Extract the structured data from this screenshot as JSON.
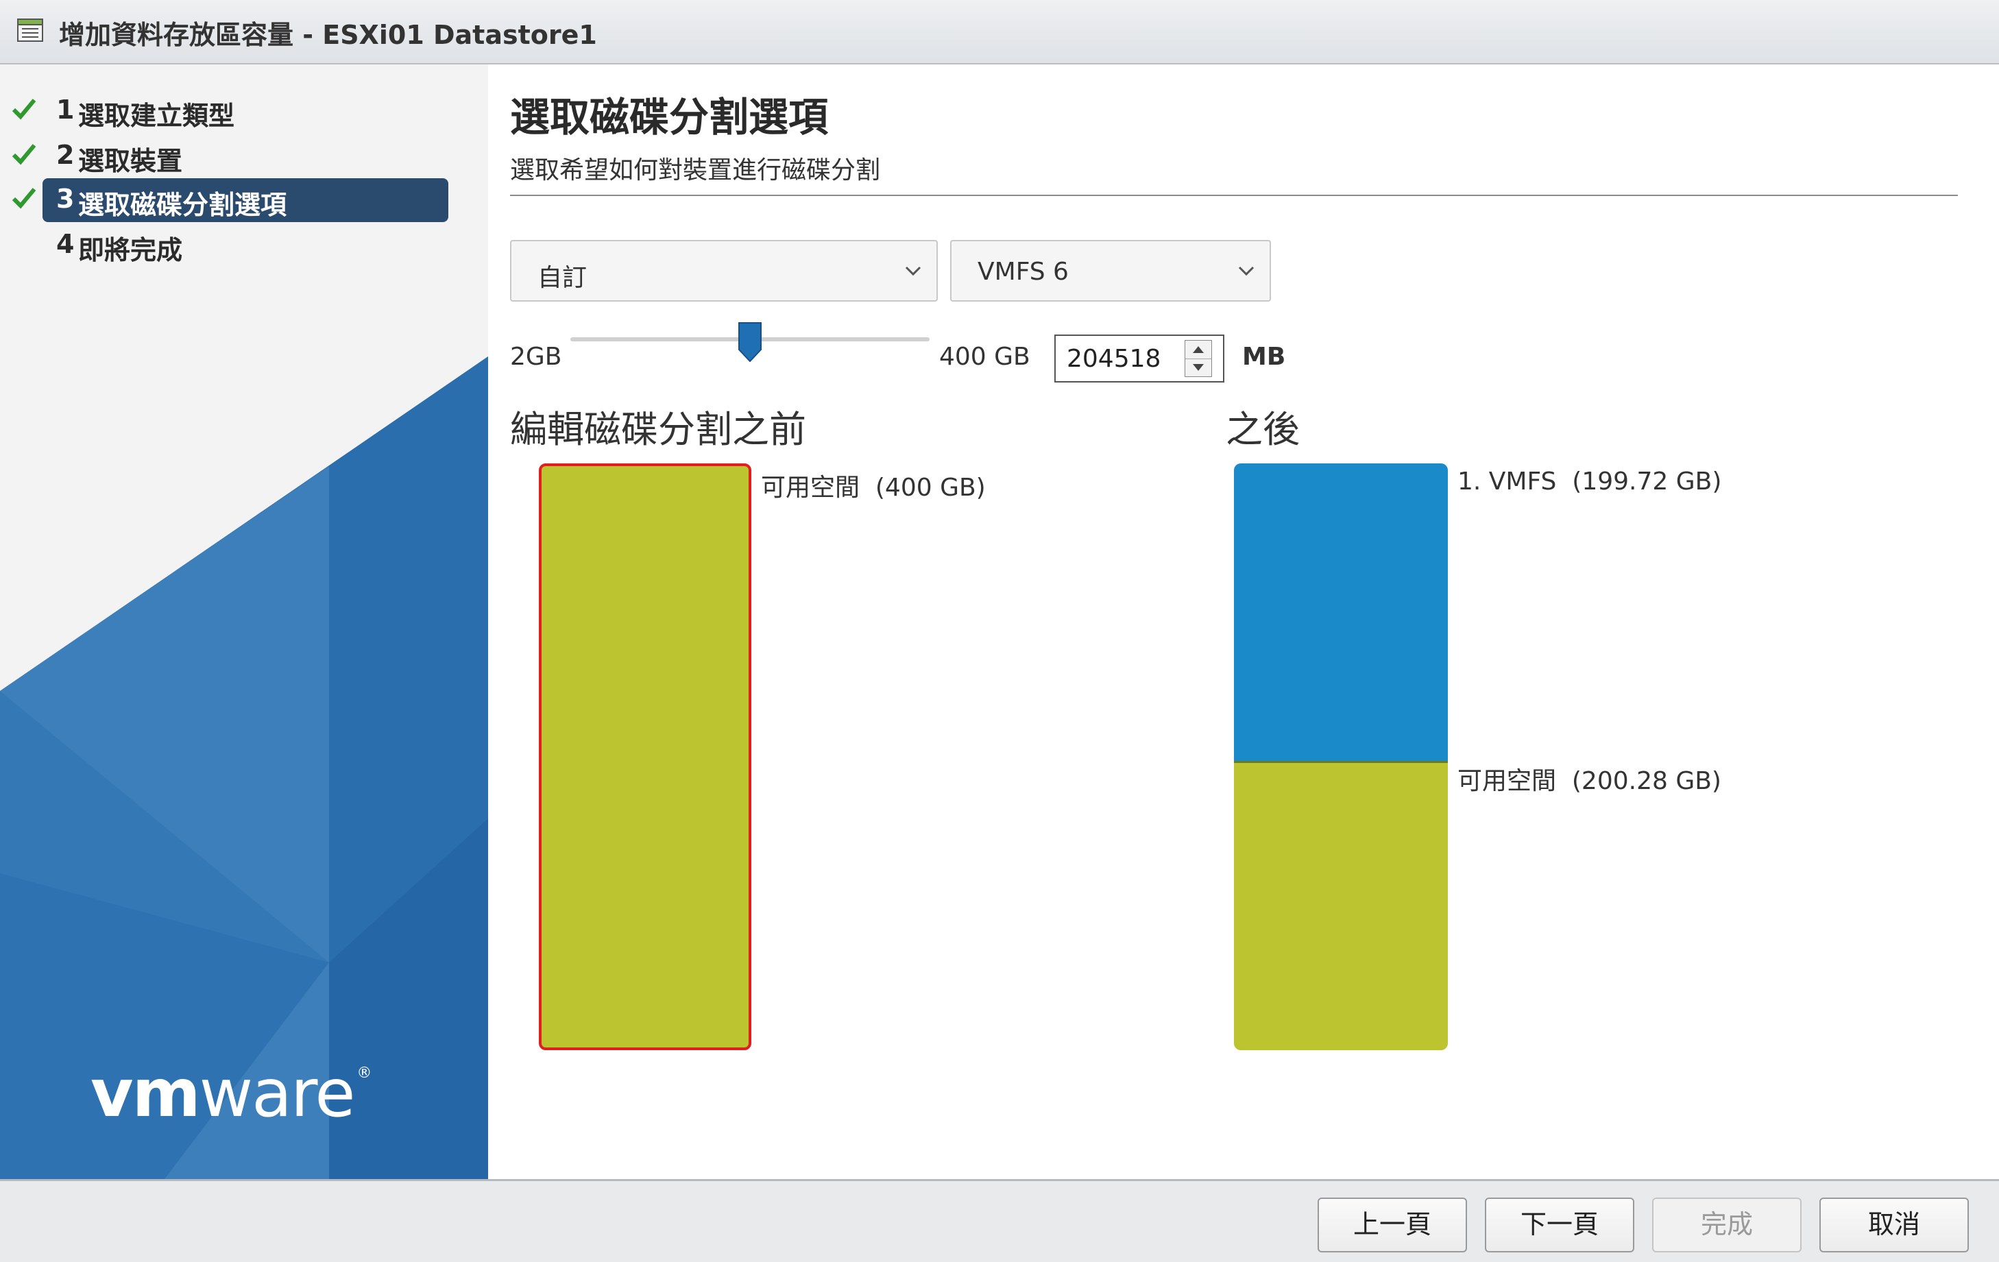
{
  "window": {
    "title": "增加資料存放區容量 - ESXi01 Datastore1",
    "icon": "datastore-icon"
  },
  "wizard": {
    "steps": [
      {
        "num": "1",
        "label": "選取建立類型",
        "completed": true,
        "active": false
      },
      {
        "num": "2",
        "label": "選取裝置",
        "completed": true,
        "active": false
      },
      {
        "num": "3",
        "label": "選取磁碟分割選項",
        "completed": true,
        "active": true
      },
      {
        "num": "4",
        "label": "即將完成",
        "completed": false,
        "active": false
      }
    ],
    "logo": {
      "vm": "vm",
      "ware": "ware",
      "reg": "®"
    }
  },
  "main": {
    "title": "選取磁碟分割選項",
    "subtitle": "選取希望如何對裝置進行磁碟分割",
    "partition_select": {
      "value": "自訂"
    },
    "format_select": {
      "value": "VMFS 6"
    },
    "slider": {
      "min_label": "2GB",
      "max_label": "400 GB",
      "value_fraction": 0.5
    },
    "size_input": {
      "value": "204518",
      "unit": "MB"
    },
    "before": {
      "heading": "編輯磁碟分割之前",
      "segments": [
        {
          "label": "可用空間  (400 GB)",
          "gb": 400,
          "color": "#bcc52f"
        }
      ]
    },
    "after": {
      "heading": "之後",
      "segments": [
        {
          "label": "1. VMFS  (199.72 GB)",
          "gb": 199.72,
          "color": "#1a8bc8"
        },
        {
          "label": "可用空間  (200.28 GB)",
          "gb": 200.28,
          "color": "#bcc52f"
        }
      ]
    }
  },
  "buttons": {
    "back": {
      "label": "上一頁",
      "enabled": true
    },
    "next": {
      "label": "下一頁",
      "enabled": true
    },
    "finish": {
      "label": "完成",
      "enabled": false
    },
    "cancel": {
      "label": "取消",
      "enabled": true
    }
  },
  "colors": {
    "accent": "#2a4a6e",
    "check": "#2e9a2e",
    "vmfs": "#1a8bc8",
    "free": "#bcc52f",
    "selected_border": "#e02020"
  }
}
